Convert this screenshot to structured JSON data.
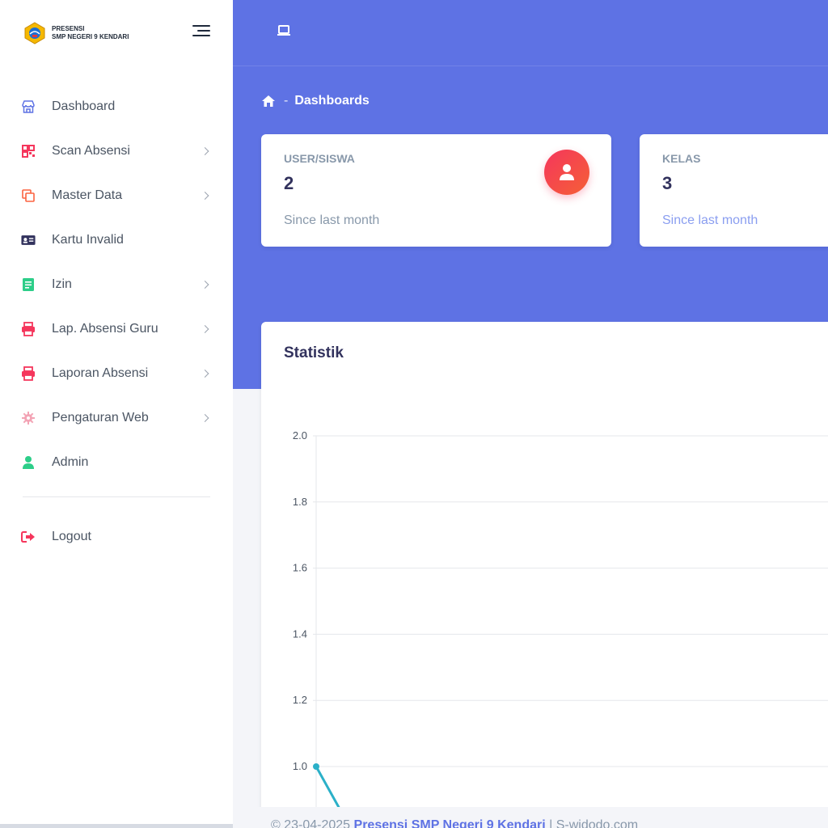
{
  "brand": {
    "line1": "PRESENSI",
    "line2": "SMP NEGERI 9 KENDARI"
  },
  "sidebar": {
    "items": [
      {
        "label": "Dashboard",
        "icon": "shop-icon",
        "color": "#5e72e4",
        "has_submenu": false
      },
      {
        "label": "Scan Absensi",
        "icon": "qr-code-icon",
        "color": "#f5365c",
        "has_submenu": true
      },
      {
        "label": "Master Data",
        "icon": "copy-icon",
        "color": "#fb6340",
        "has_submenu": true
      },
      {
        "label": "Kartu Invalid",
        "icon": "id-card-icon",
        "color": "#32325d",
        "has_submenu": false
      },
      {
        "label": "Izin",
        "icon": "document-icon",
        "color": "#2dce89",
        "has_submenu": true
      },
      {
        "label": "Lap. Absensi Guru",
        "icon": "printer-icon",
        "color": "#f5365c",
        "has_submenu": true
      },
      {
        "label": "Laporan Absensi",
        "icon": "printer-icon",
        "color": "#f5365c",
        "has_submenu": true
      },
      {
        "label": "Pengaturan Web",
        "icon": "gear-icon",
        "color": "#f3a4b5",
        "has_submenu": true
      },
      {
        "label": "Admin",
        "icon": "user-icon",
        "color": "#2dce89",
        "has_submenu": false
      }
    ],
    "logout": {
      "label": "Logout",
      "icon": "sign-out-icon",
      "color": "#f5365c"
    }
  },
  "breadcrumb": {
    "separator": "-",
    "current": "Dashboards"
  },
  "cards": [
    {
      "title": "USER/SISWA",
      "value": "2",
      "note": "Since last month",
      "icon": "user-icon"
    },
    {
      "title": "KELAS",
      "value": "3",
      "note": "Since last month"
    }
  ],
  "statistik": {
    "title": "Statistik"
  },
  "chart_data": {
    "type": "line",
    "title": "Statistik",
    "ylim": [
      1.0,
      2.0
    ],
    "yticks": [
      "2.0",
      "1.8",
      "1.6",
      "1.4",
      "1.2",
      "1.0"
    ],
    "series": [
      {
        "values": [
          1.0
        ],
        "color": "#2bb0c8"
      }
    ],
    "grid": true
  },
  "footer": {
    "date": "© 23-04-2025",
    "link": "Presensi SMP Negeri 9 Kendari",
    "separator": "|",
    "credit": "S-widodo.com"
  },
  "colors": {
    "primary": "#5e72e4",
    "danger": "#f5365c",
    "success": "#2dce89"
  }
}
